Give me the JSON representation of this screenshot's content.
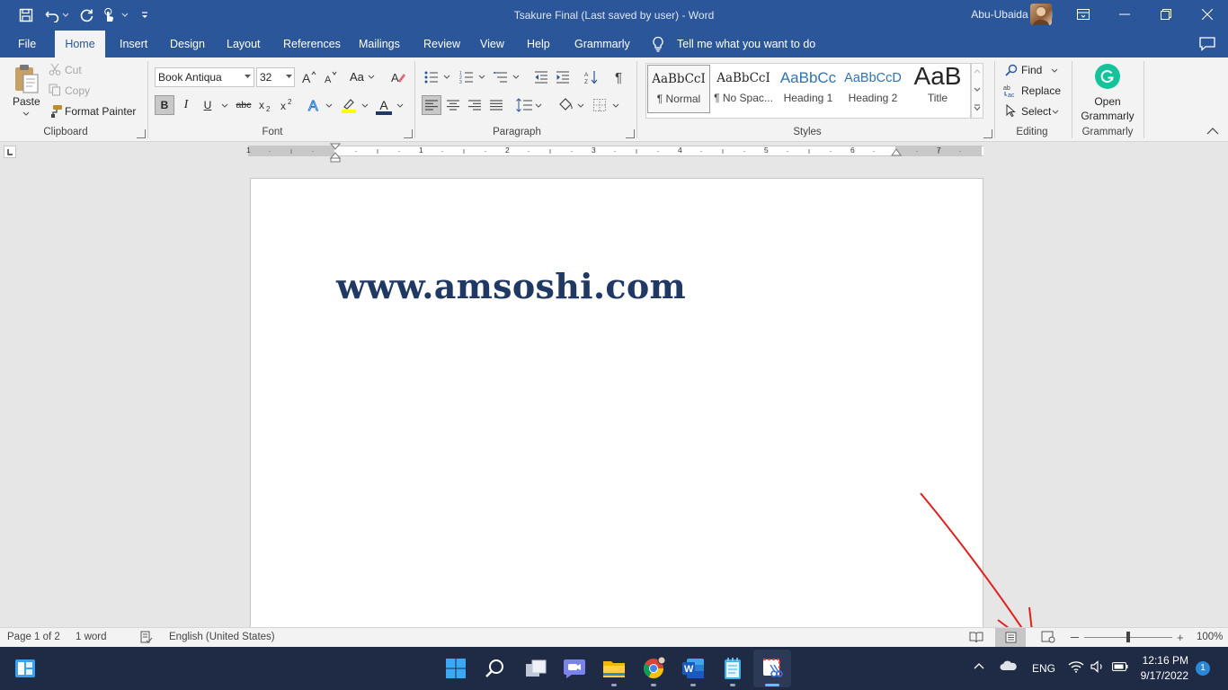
{
  "titlebar": {
    "document_title": "Tsakure Final (Last saved by user)  -  Word",
    "user_name": "Abu-Ubaida Sani"
  },
  "tabs": [
    "File",
    "Home",
    "Insert",
    "Design",
    "Layout",
    "References",
    "Mailings",
    "Review",
    "View",
    "Help",
    "Grammarly"
  ],
  "active_tab": "Home",
  "tell_me": "Tell me what you want to do",
  "clipboard": {
    "paste": "Paste",
    "cut": "Cut",
    "copy": "Copy",
    "format_painter": "Format Painter",
    "label": "Clipboard"
  },
  "font": {
    "name": "Book Antiqua",
    "size": "32",
    "label": "Font",
    "case_label": "Aa",
    "color_letter": "A",
    "strike_label": "abc"
  },
  "paragraph": {
    "label": "Paragraph"
  },
  "styles": {
    "label": "Styles",
    "items": [
      {
        "preview": "AaBbCcI",
        "name": "¶ Normal"
      },
      {
        "preview": "AaBbCcI",
        "name": "¶ No Spac..."
      },
      {
        "preview": "AaBbCc",
        "name": "Heading 1"
      },
      {
        "preview": "AaBbCcD",
        "name": "Heading 2"
      },
      {
        "preview": "AaB",
        "name": "Title"
      }
    ]
  },
  "editing": {
    "find": "Find",
    "replace": "Replace",
    "select": "Select",
    "label": "Editing"
  },
  "grammarly": {
    "open_line1": "Open",
    "open_line2": "Grammarly",
    "label": "Grammarly"
  },
  "ruler": {
    "numbers": [
      "1",
      "1",
      "2",
      "3",
      "4",
      "5",
      "6",
      "7"
    ]
  },
  "document": {
    "text": "www.amsoshi.com"
  },
  "status": {
    "page": "Page 1 of 2",
    "words": "1 word",
    "language": "English (United States)",
    "zoom": "100%"
  },
  "taskbar": {
    "language": "ENG",
    "time": "12:16 PM",
    "date": "9/17/2022",
    "notifications": "1"
  },
  "colors": {
    "brand": "#2b579a",
    "doc_text": "#1f3864",
    "annotation": "#e0201f",
    "taskbar": "#1f2a44"
  }
}
